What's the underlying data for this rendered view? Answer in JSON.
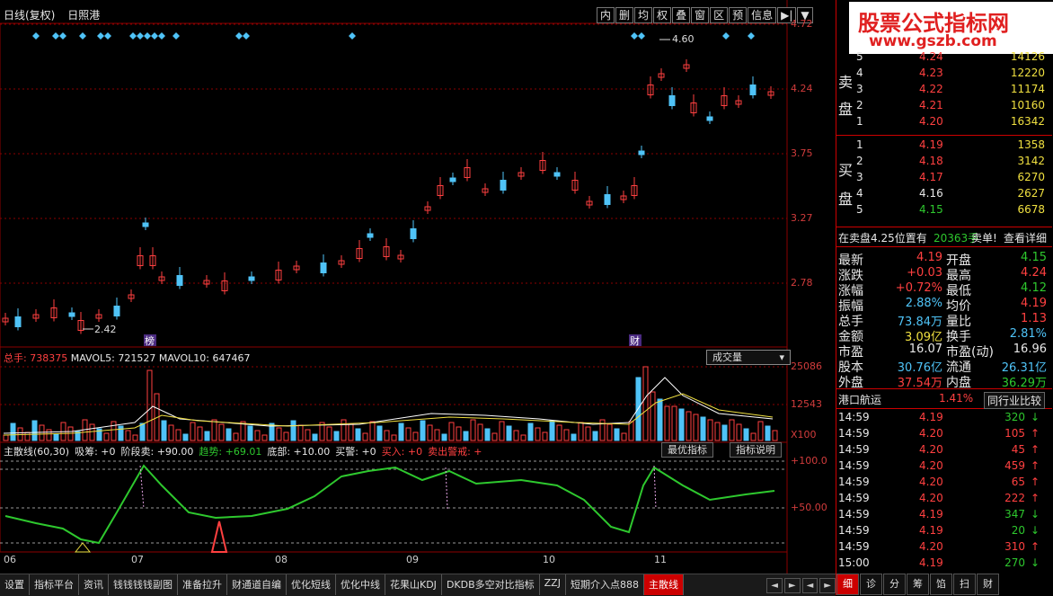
{
  "header": {
    "chart_type": "日线(复权)",
    "stock_name": "日照港"
  },
  "toolbar": [
    "内",
    "删",
    "均",
    "权",
    "叠",
    "窗",
    "区",
    "预",
    "信息",
    "▶|",
    "▼"
  ],
  "price_axis": [
    "4.72",
    "4.24",
    "3.75",
    "3.27",
    "2.78"
  ],
  "price_annotations": {
    "high": "4.60",
    "low": "2.42",
    "badge1": "榜",
    "badge2": "财"
  },
  "volume": {
    "total_label": "总手: 738375",
    "mavol5": "MAVOL5: 721527",
    "mavol10": "MAVOL10: 647467",
    "selector": "成交量",
    "axis": [
      "25086",
      "12543",
      "X100"
    ]
  },
  "indicator": {
    "name": "主散线(60,30)",
    "items": [
      "吸筹: +0",
      "阶段卖: +90.00",
      "趋势: +69.01",
      "底部: +10.00",
      "买警: +0",
      "买入: +0",
      "卖出警戒: +"
    ],
    "btn_best": "最优指标",
    "btn_desc": "指标说明",
    "axis": [
      "+100.0",
      "+50.00"
    ]
  },
  "xaxis": [
    "06",
    "07",
    "08",
    "09",
    "10",
    "11"
  ],
  "bottom_tabs": [
    "设置",
    "指标平台",
    "资讯",
    "钱钱钱钱副图",
    "准备拉升",
    "财通道自编",
    "优化短线",
    "优化中线",
    "花果山KDJ",
    "DKDB多空对比指标",
    "ZZJ",
    "短期介入点888",
    "主散线"
  ],
  "nav": [
    "◄",
    "►",
    "◄",
    "►"
  ],
  "logo": {
    "line1": "股票公式指标网",
    "line2": "www.gszb.com"
  },
  "order_book": {
    "sell_label": [
      "卖",
      "盘"
    ],
    "buy_label": [
      "买",
      "盘"
    ],
    "sells": [
      {
        "n": "5",
        "p": "4.24",
        "v": "14126"
      },
      {
        "n": "4",
        "p": "4.23",
        "v": "12220"
      },
      {
        "n": "3",
        "p": "4.22",
        "v": "11174"
      },
      {
        "n": "2",
        "p": "4.21",
        "v": "10160"
      },
      {
        "n": "1",
        "p": "4.20",
        "v": "16342"
      }
    ],
    "buys": [
      {
        "n": "1",
        "p": "4.19",
        "v": "1358"
      },
      {
        "n": "2",
        "p": "4.18",
        "v": "3142"
      },
      {
        "n": "3",
        "p": "4.17",
        "v": "6270"
      },
      {
        "n": "4",
        "p": "4.16",
        "v": "2627"
      },
      {
        "n": "5",
        "p": "4.15",
        "v": "6678"
      }
    ]
  },
  "order_note": {
    "text": "在卖盘4.25位置有",
    "qty": "20363手",
    "action": "卖单!",
    "link": "查看详细"
  },
  "stats": [
    {
      "l": "最新",
      "v": "4.19",
      "l2": "开盘",
      "v2": "4.15"
    },
    {
      "l": "涨跌",
      "v": "+0.03",
      "l2": "最高",
      "v2": "4.24"
    },
    {
      "l": "涨幅",
      "v": "+0.72%",
      "l2": "最低",
      "v2": "4.12"
    },
    {
      "l": "振幅",
      "v": "2.88%",
      "l2": "均价",
      "v2": "4.19"
    },
    {
      "l": "总手",
      "v": "73.84万",
      "l2": "量比",
      "v2": "1.13"
    },
    {
      "l": "金额",
      "v": "3.09亿",
      "l2": "换手",
      "v2": "2.81%"
    },
    {
      "l": "市盈",
      "v": "16.07",
      "l2": "市盈(动)",
      "v2": "16.96"
    },
    {
      "l": "股本",
      "v": "30.76亿",
      "l2": "流通",
      "v2": "26.31亿"
    },
    {
      "l": "外盘",
      "v": "37.54万",
      "l2": "内盘",
      "v2": "36.29万"
    }
  ],
  "sector": {
    "name": "港口航运",
    "change": "1.41%",
    "btn": "同行业比较"
  },
  "ticks": [
    {
      "t": "14:59",
      "p": "4.19",
      "v": "320",
      "d": "down"
    },
    {
      "t": "14:59",
      "p": "4.20",
      "v": "105",
      "d": "up"
    },
    {
      "t": "14:59",
      "p": "4.20",
      "v": "45",
      "d": "up"
    },
    {
      "t": "14:59",
      "p": "4.20",
      "v": "459",
      "d": "up"
    },
    {
      "t": "14:59",
      "p": "4.20",
      "v": "65",
      "d": "up"
    },
    {
      "t": "14:59",
      "p": "4.20",
      "v": "222",
      "d": "up"
    },
    {
      "t": "14:59",
      "p": "4.19",
      "v": "347",
      "d": "down"
    },
    {
      "t": "14:59",
      "p": "4.19",
      "v": "20",
      "d": "down"
    },
    {
      "t": "14:59",
      "p": "4.20",
      "v": "310",
      "d": "up"
    },
    {
      "t": "15:00",
      "p": "4.19",
      "v": "270",
      "d": "down"
    }
  ],
  "panel_tabs": [
    "细",
    "诊",
    "分",
    "筹",
    "馅",
    "扫",
    "财"
  ],
  "colors": {
    "up": "#ff4040",
    "down": "#4fc3f7",
    "green": "#2ec82e",
    "grid": "#8b0000",
    "ma_white": "#ffffff",
    "ma_yellow": "#f0e040"
  }
}
